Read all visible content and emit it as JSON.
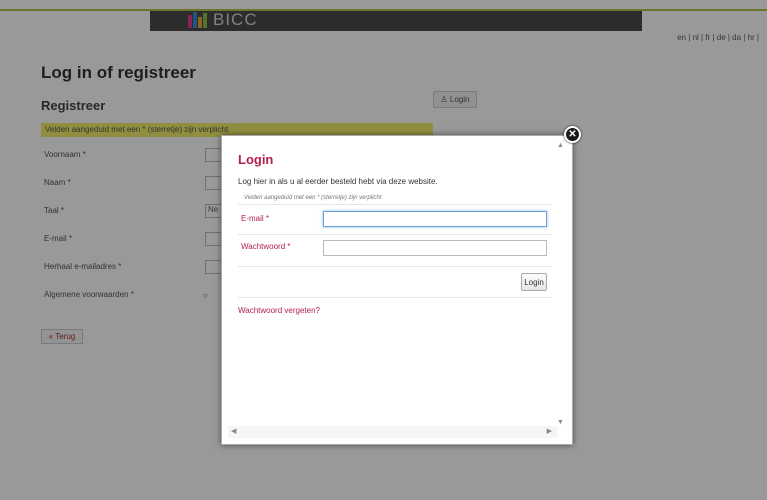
{
  "header": {
    "logo_text": "BICC",
    "brand_colors": [
      "#e23d8e",
      "#3a8fd9",
      "#f2a33a",
      "#8cc04a"
    ],
    "languages": "en | nl | fr | de | da | hr |"
  },
  "page": {
    "title": "Log in of registreer",
    "section_title": "Registreer",
    "login_button": "Login",
    "required_note": "Velden aangeduid met een * (sterretje) zijn verplicht",
    "fields": [
      {
        "label": "Voornaam *"
      },
      {
        "label": "Naam *"
      },
      {
        "label": "Taal *",
        "value": "Ne"
      },
      {
        "label": "E-mail *"
      },
      {
        "label": "Herhaal e-mailadres *"
      },
      {
        "label": "Algemene voorwaarden *"
      }
    ],
    "back_button": "« Terug"
  },
  "modal": {
    "title": "Login",
    "intro": "Log hier in als u al eerder besteld hebt via deze website.",
    "required_note": "Velden aangeduid met een * (sterretje) zijn verplicht",
    "email_label": "E-mail *",
    "email_value": "",
    "password_label": "Wachtwoord *",
    "password_value": "",
    "submit_label": "Login",
    "forgot_link": "Wachtwoord vergeten?",
    "accent_color": "#b0224a"
  }
}
